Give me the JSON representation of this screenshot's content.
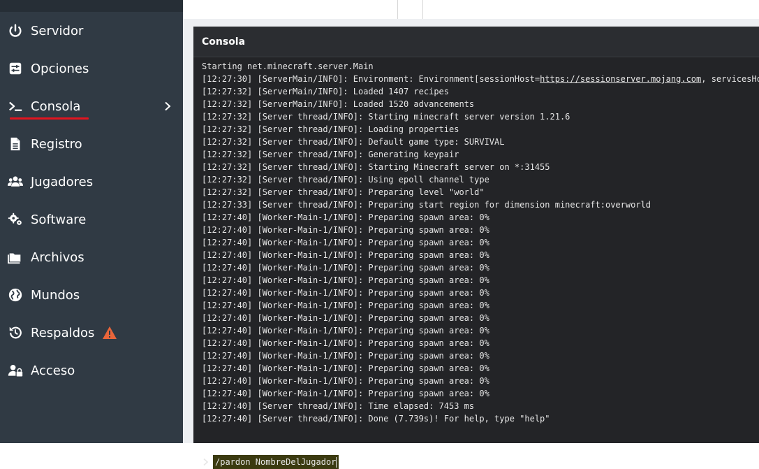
{
  "sidebar": {
    "items": [
      {
        "label": "Servidor",
        "icon": "power-icon"
      },
      {
        "label": "Opciones",
        "icon": "sliders-icon"
      },
      {
        "label": "Consola",
        "icon": "terminal-icon",
        "active": true
      },
      {
        "label": "Registro",
        "icon": "file-icon"
      },
      {
        "label": "Jugadores",
        "icon": "users-icon"
      },
      {
        "label": "Software",
        "icon": "gears-icon"
      },
      {
        "label": "Archivos",
        "icon": "folder-icon"
      },
      {
        "label": "Mundos",
        "icon": "globe-icon"
      },
      {
        "label": "Respaldos",
        "icon": "history-icon",
        "warning": true
      },
      {
        "label": "Acceso",
        "icon": "user-lock-icon"
      }
    ],
    "active_accent": "#e3141f",
    "warning_color": "#e8653a"
  },
  "console": {
    "title": "Consola",
    "lines": [
      "Starting net.minecraft.server.Main",
      "[12:27:30] [ServerMain/INFO]: Environment: Environment[sessionHost=",
      "[12:27:32] [ServerMain/INFO]: Loaded 1407 recipes",
      "[12:27:32] [ServerMain/INFO]: Loaded 1520 advancements",
      "[12:27:32] [Server thread/INFO]: Starting minecraft server version 1.21.6",
      "[12:27:32] [Server thread/INFO]: Loading properties",
      "[12:27:32] [Server thread/INFO]: Default game type: SURVIVAL",
      "[12:27:32] [Server thread/INFO]: Generating keypair",
      "[12:27:32] [Server thread/INFO]: Starting Minecraft server on *:31455",
      "[12:27:32] [Server thread/INFO]: Using epoll channel type",
      "[12:27:32] [Server thread/INFO]: Preparing level \"world\"",
      "[12:27:33] [Server thread/INFO]: Preparing start region for dimension minecraft:overworld",
      "[12:27:40] [Worker-Main-1/INFO]: Preparing spawn area: 0%",
      "[12:27:40] [Worker-Main-1/INFO]: Preparing spawn area: 0%",
      "[12:27:40] [Worker-Main-1/INFO]: Preparing spawn area: 0%",
      "[12:27:40] [Worker-Main-1/INFO]: Preparing spawn area: 0%",
      "[12:27:40] [Worker-Main-1/INFO]: Preparing spawn area: 0%",
      "[12:27:40] [Worker-Main-1/INFO]: Preparing spawn area: 0%",
      "[12:27:40] [Worker-Main-1/INFO]: Preparing spawn area: 0%",
      "[12:27:40] [Worker-Main-1/INFO]: Preparing spawn area: 0%",
      "[12:27:40] [Worker-Main-1/INFO]: Preparing spawn area: 0%",
      "[12:27:40] [Worker-Main-1/INFO]: Preparing spawn area: 0%",
      "[12:27:40] [Worker-Main-1/INFO]: Preparing spawn area: 0%",
      "[12:27:40] [Worker-Main-1/INFO]: Preparing spawn area: 0%",
      "[12:27:40] [Worker-Main-1/INFO]: Preparing spawn area: 0%",
      "[12:27:40] [Worker-Main-1/INFO]: Preparing spawn area: 0%",
      "[12:27:40] [Worker-Main-1/INFO]: Preparing spawn area: 0%",
      "[12:27:40] [Server thread/INFO]: Time elapsed: 7453 ms",
      "[12:27:40] [Server thread/INFO]: Done (7.739s)! For help, type \"help\""
    ],
    "line1_link": "https://sessionserver.mojang.com",
    "line1_tail": ", servicesHo",
    "command_value": "/pardon NombreDelJugador"
  }
}
